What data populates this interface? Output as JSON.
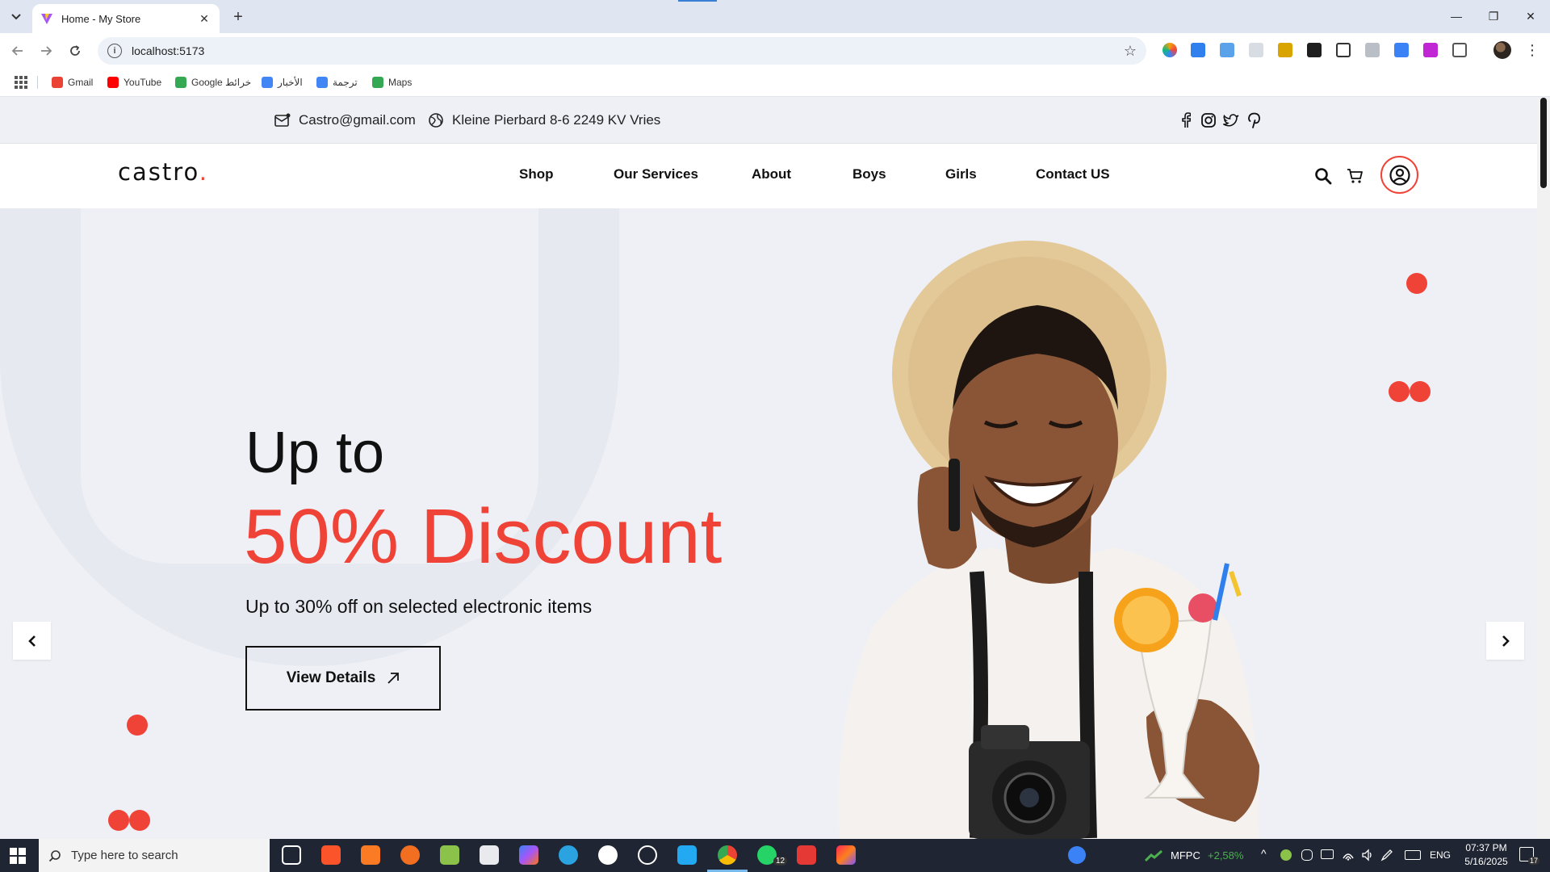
{
  "browser": {
    "tab_title": "Home - My Store",
    "new_tab": "+",
    "url": "localhost:5173",
    "bookmarks": [
      {
        "label": "Gmail",
        "color": "#ea4335"
      },
      {
        "label": "YouTube",
        "color": "#ff0000"
      },
      {
        "label": "Google خرائط",
        "color": "#34a853"
      },
      {
        "label": "الأخبار",
        "color": "#4285f4"
      },
      {
        "label": "ترجمة",
        "color": "#4285f4"
      },
      {
        "label": "Maps",
        "color": "#34a853"
      }
    ]
  },
  "site": {
    "email": "Castro@gmail.com",
    "address": "Kleine Pierbard 8-6 2249 KV Vries",
    "logo_text": "castro",
    "logo_dot": ".",
    "nav": [
      "Shop",
      "Our Services",
      "About",
      "Boys",
      "Girls",
      "Contact US"
    ],
    "hero": {
      "line1": "Up to",
      "line2": "50% Discount",
      "subtitle": "Up to 30% off on selected electronic items",
      "button": "View Details"
    },
    "colors": {
      "accent": "#f04338",
      "text": "#111111",
      "background": "#eef0f5"
    }
  },
  "taskbar": {
    "search_placeholder": "Type here to search",
    "stock_name": "MFPC",
    "stock_change": "+2,58%",
    "language": "ENG",
    "time": "07:37 PM",
    "date": "5/16/2025",
    "whatsapp_badge": "12",
    "notifications": "17"
  }
}
